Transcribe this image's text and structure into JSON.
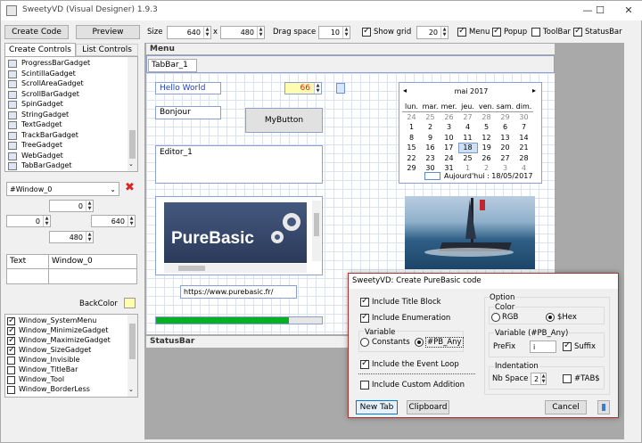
{
  "window": {
    "title": "SweetyVD (Visual Designer) 1.9.3",
    "minimize": "—",
    "maximize": "☐",
    "close": "✕"
  },
  "toolbar": {
    "create_code": "Create Code",
    "preview": "Preview",
    "size_label": "Size",
    "size_w": "640",
    "size_x": "x",
    "size_h": "480",
    "drag_label": "Drag space",
    "drag_value": "10",
    "show_grid": "Show grid",
    "grid_value": "20",
    "menu": "Menu",
    "popup": "Popup",
    "toolbar": "ToolBar",
    "statusbar": "StatusBar"
  },
  "left": {
    "tab_create": "Create Controls",
    "tab_list": "List Controls",
    "gadgets": [
      {
        "label": "ProgressBarGadget"
      },
      {
        "label": "ScintillaGadget"
      },
      {
        "label": "ScrollAreaGadget"
      },
      {
        "label": "ScrollBarGadget"
      },
      {
        "label": "SpinGadget"
      },
      {
        "label": "StringGadget"
      },
      {
        "label": "TextGadget"
      },
      {
        "label": "TrackBarGadget"
      },
      {
        "label": "TreeGadget"
      },
      {
        "label": "WebGadget"
      },
      {
        "label": "TabBarGadget"
      }
    ],
    "window_select": "#Window_0",
    "pos_y": "0",
    "pos_x": "0",
    "width": "640",
    "height": "480",
    "prop_key": "Text",
    "prop_value": "Window_0",
    "backcolor": "BackColor",
    "flags": [
      {
        "label": "Window_SystemMenu",
        "checked": true
      },
      {
        "label": "Window_MinimizeGadget",
        "checked": true
      },
      {
        "label": "Window_MaximizeGadget",
        "checked": true
      },
      {
        "label": "Window_SizeGadget",
        "checked": true
      },
      {
        "label": "Window_Invisible",
        "checked": false
      },
      {
        "label": "Window_TitleBar",
        "checked": false
      },
      {
        "label": "Window_Tool",
        "checked": false
      },
      {
        "label": "Window_BorderLess",
        "checked": false
      }
    ]
  },
  "design": {
    "menu": "Menu",
    "tab": "TabBar_1",
    "statusbar": "StatusBar",
    "hello": "Hello World",
    "spin_value": "66",
    "bonjour": "Bonjour",
    "mybutton": "MyButton",
    "editor": "Editor_1",
    "url": "https://www.purebasic.fr/",
    "logo_text": "PureBasic",
    "calendar": {
      "month": "mai 2017",
      "days": [
        "lun.",
        "mar.",
        "mer.",
        "jeu.",
        "ven.",
        "sam.",
        "dim."
      ],
      "weeks": [
        [
          "24",
          "25",
          "26",
          "27",
          "28",
          "29",
          "30"
        ],
        [
          "1",
          "2",
          "3",
          "4",
          "5",
          "6",
          "7"
        ],
        [
          "8",
          "9",
          "10",
          "11",
          "12",
          "13",
          "14"
        ],
        [
          "15",
          "16",
          "17",
          "18",
          "19",
          "20",
          "21"
        ],
        [
          "22",
          "23",
          "24",
          "25",
          "26",
          "27",
          "28"
        ],
        [
          "29",
          "30",
          "31",
          "1",
          "2",
          "3",
          "4"
        ]
      ],
      "today": "Aujourd'hui : 18/05/2017"
    }
  },
  "dialog": {
    "title": "SweetyVD: Create PureBasic code",
    "include_title": "Include Title Block",
    "include_enum": "Include Enumeration",
    "variable": "Variable",
    "constants": "Constants",
    "pb_any": "#PB_Any",
    "include_event": "Include the Event Loop",
    "include_custom": "Include Custom Addition",
    "option": "Option",
    "color": "Color",
    "rgb": "RGB",
    "hex": "$Hex",
    "var_pb": "Variable (#PB_Any)",
    "prefix": "PreFix",
    "prefix_value": "i",
    "suffix": "Suffix",
    "indentation": "Indentation",
    "nbspace": "Nb Space",
    "nbspace_value": "2",
    "tabs": "#TAB$",
    "new_tab": "New Tab",
    "clipboard": "Clipboard",
    "cancel": "Cancel"
  }
}
